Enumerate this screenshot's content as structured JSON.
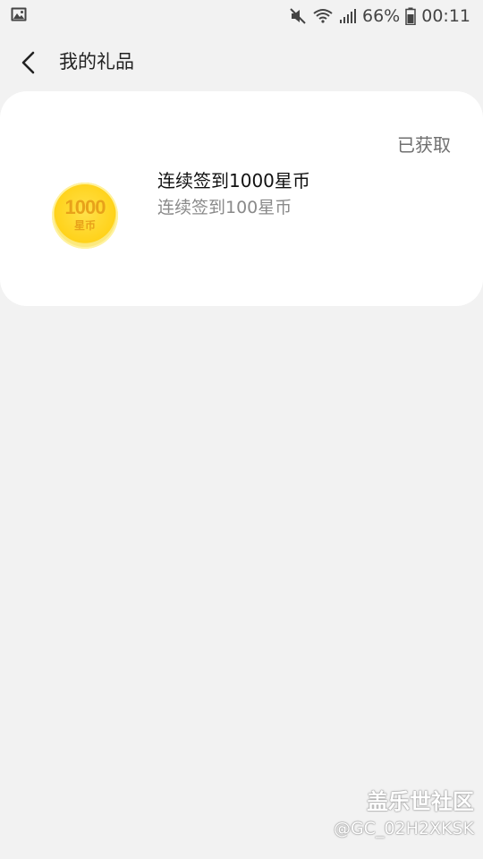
{
  "status_bar": {
    "battery": "66%",
    "time": "00:11"
  },
  "header": {
    "title": "我的礼品"
  },
  "gift": {
    "status": "已获取",
    "coin_amount": "1000",
    "coin_unit": "星币",
    "title": "连续签到1000星币",
    "description": "连续签到100星币"
  },
  "watermark": {
    "name": "盖乐世社区",
    "user": "@GC_02H2XKSK"
  }
}
